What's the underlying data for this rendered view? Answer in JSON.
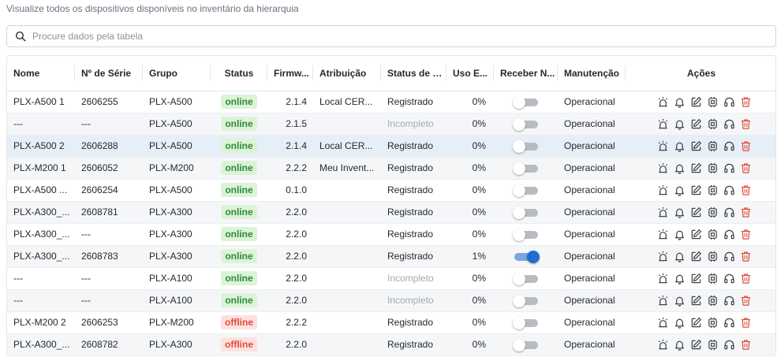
{
  "subtitle": "Visualize todos os dispositivos disponíveis no inventário da hierarquia",
  "search": {
    "placeholder": "Procure dados pela tabela",
    "value": ""
  },
  "colors": {
    "online_bg": "#dcf3d8",
    "online_text": "#2e8b3a",
    "offline_bg": "#fde1de",
    "offline_text": "#e04b3a",
    "toggle_on": "#1f6fd1",
    "delete": "#e04b3a"
  },
  "columns": {
    "nome": "Nome",
    "serie": "Nº de Série",
    "grupo": "Grupo",
    "status": "Status",
    "firmware": "Firmw...",
    "atribuicao": "Atribuição",
    "status_registro": "Status de R...",
    "uso": "Uso E...",
    "receber": "Receber N...",
    "manutencao": "Manutenção",
    "acoes": "Ações"
  },
  "action_icons": [
    "alarm-icon",
    "bell-icon",
    "edit-icon",
    "chip-icon",
    "headset-icon",
    "trash-icon"
  ],
  "rows": [
    {
      "nome": "PLX-A500 1",
      "serie": "2606255",
      "grupo": "PLX-A500",
      "status": "online",
      "firmware": "2.1.4",
      "atribuicao": "Local CER...",
      "registro": "Registrado",
      "registro_muted": false,
      "uso": "0%",
      "receber": false,
      "manutencao": "Operacional",
      "selected": false
    },
    {
      "nome": "---",
      "serie": "---",
      "grupo": "PLX-A500",
      "status": "online",
      "firmware": "2.1.5",
      "atribuicao": "",
      "registro": "Incompleto",
      "registro_muted": true,
      "uso": "0%",
      "receber": false,
      "manutencao": "Operacional",
      "selected": false
    },
    {
      "nome": "PLX-A500 2",
      "serie": "2606288",
      "grupo": "PLX-A500",
      "status": "online",
      "firmware": "2.1.4",
      "atribuicao": "Local CER...",
      "registro": "Registrado",
      "registro_muted": false,
      "uso": "0%",
      "receber": false,
      "manutencao": "Operacional",
      "selected": true
    },
    {
      "nome": "PLX-M200 1",
      "serie": "2606052",
      "grupo": "PLX-M200",
      "status": "online",
      "firmware": "2.2.2",
      "atribuicao": "Meu Invent...",
      "registro": "Registrado",
      "registro_muted": false,
      "uso": "0%",
      "receber": false,
      "manutencao": "Operacional",
      "selected": false
    },
    {
      "nome": "PLX-A500 ...",
      "serie": "2606254",
      "grupo": "PLX-A500",
      "status": "online",
      "firmware": "0.1.0",
      "atribuicao": "",
      "registro": "Registrado",
      "registro_muted": false,
      "uso": "0%",
      "receber": false,
      "manutencao": "Operacional",
      "selected": false
    },
    {
      "nome": "PLX-A300_...",
      "serie": "2608781",
      "grupo": "PLX-A300",
      "status": "online",
      "firmware": "2.2.0",
      "atribuicao": "",
      "registro": "Registrado",
      "registro_muted": false,
      "uso": "0%",
      "receber": false,
      "manutencao": "Operacional",
      "selected": false
    },
    {
      "nome": "PLX-A300_...",
      "serie": "---",
      "grupo": "PLX-A300",
      "status": "online",
      "firmware": "2.2.0",
      "atribuicao": "",
      "registro": "Registrado",
      "registro_muted": false,
      "uso": "0%",
      "receber": false,
      "manutencao": "Operacional",
      "selected": false
    },
    {
      "nome": "PLX-A300_...",
      "serie": "2608783",
      "grupo": "PLX-A300",
      "status": "online",
      "firmware": "2.2.0",
      "atribuicao": "",
      "registro": "Registrado",
      "registro_muted": false,
      "uso": "1%",
      "receber": true,
      "manutencao": "Operacional",
      "selected": false
    },
    {
      "nome": "---",
      "serie": "---",
      "grupo": "PLX-A100",
      "status": "online",
      "firmware": "2.2.0",
      "atribuicao": "",
      "registro": "Incompleto",
      "registro_muted": true,
      "uso": "0%",
      "receber": false,
      "manutencao": "Operacional",
      "selected": false
    },
    {
      "nome": "---",
      "serie": "---",
      "grupo": "PLX-A100",
      "status": "online",
      "firmware": "2.2.0",
      "atribuicao": "",
      "registro": "Incompleto",
      "registro_muted": true,
      "uso": "0%",
      "receber": false,
      "manutencao": "Operacional",
      "selected": false
    },
    {
      "nome": "PLX-M200 2",
      "serie": "2606253",
      "grupo": "PLX-M200",
      "status": "offline",
      "firmware": "2.2.2",
      "atribuicao": "",
      "registro": "Registrado",
      "registro_muted": false,
      "uso": "0%",
      "receber": false,
      "manutencao": "Operacional",
      "selected": false
    },
    {
      "nome": "PLX-A300_...",
      "serie": "2608782",
      "grupo": "PLX-A300",
      "status": "offline",
      "firmware": "2.2.0",
      "atribuicao": "",
      "registro": "Registrado",
      "registro_muted": false,
      "uso": "0%",
      "receber": false,
      "manutencao": "Operacional",
      "selected": false
    }
  ]
}
